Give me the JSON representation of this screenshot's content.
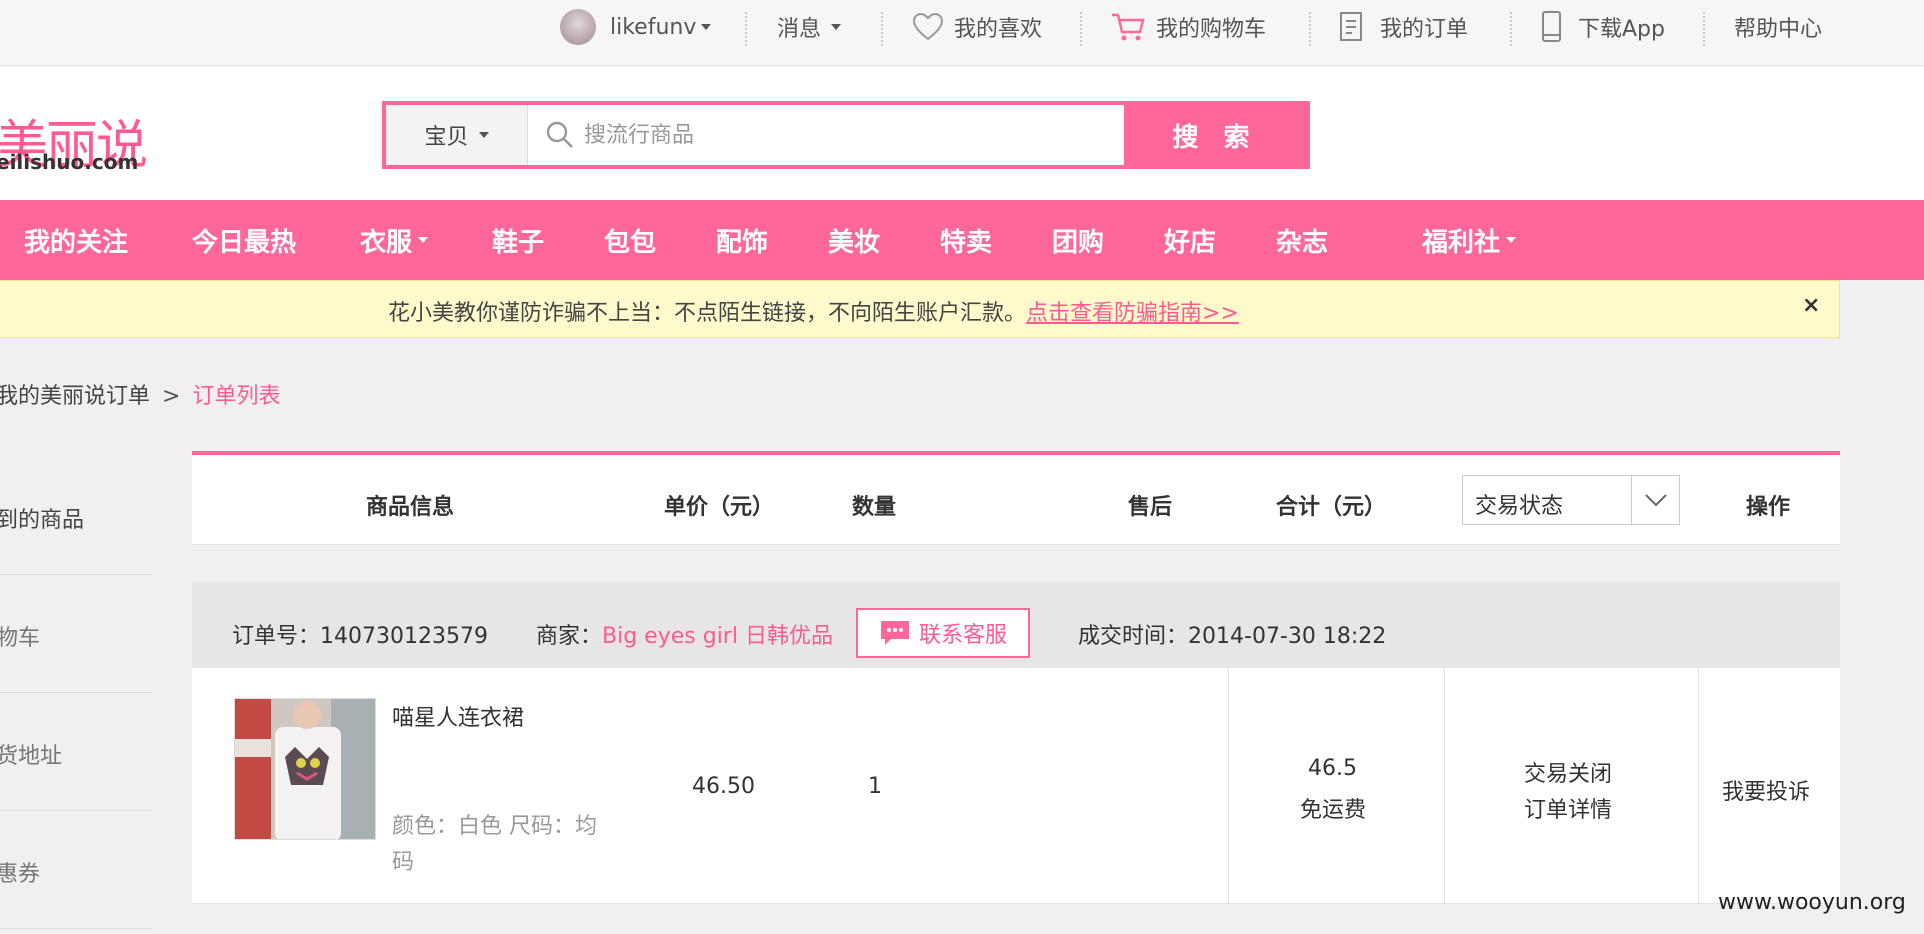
{
  "topbar": {
    "username": "likefunv",
    "messages": "消息",
    "favorites": "我的喜欢",
    "cart": "我的购物车",
    "orders": "我的订单",
    "download_app": "下载App",
    "help": "帮助中心"
  },
  "header": {
    "logo_main": "美丽说",
    "logo_sub": "eilishuo.com",
    "search": {
      "category": "宝贝",
      "placeholder": "搜流行商品",
      "button": "搜 索"
    }
  },
  "nav": {
    "items": [
      {
        "label": "我的关注"
      },
      {
        "label": "今日最热"
      },
      {
        "label": "衣服"
      },
      {
        "label": "鞋子"
      },
      {
        "label": "包包"
      },
      {
        "label": "配饰"
      },
      {
        "label": "美妆"
      },
      {
        "label": "特卖"
      },
      {
        "label": "团购"
      },
      {
        "label": "好店"
      },
      {
        "label": "杂志"
      },
      {
        "label": "福利社"
      }
    ]
  },
  "notice": {
    "text": "花小美教你谨防诈骗不上当：不点陌生链接，不向陌生账户汇款。",
    "link": "点击查看防骗指南>>",
    "close": "×"
  },
  "breadcrumb": {
    "parent": "我的美丽说订单",
    "separator": ">",
    "current": "订单列表"
  },
  "sidebar": {
    "items": [
      "到的商品",
      "物车",
      "货地址",
      "惠券"
    ]
  },
  "table": {
    "headers": {
      "product": "商品信息",
      "price": "单价（元）",
      "qty": "数量",
      "aftersale": "售后",
      "total": "合计（元）",
      "status_select": "交易状态",
      "action": "操作"
    }
  },
  "order": {
    "order_no_label": "订单号：",
    "order_no": "140730123579",
    "merchant_label": "商家：",
    "merchant": "Big eyes girl 日韩优品",
    "contact": "联系客服",
    "time_label": "成交时间：",
    "time": "2014-07-30 18:22",
    "item": {
      "name": "喵星人连衣裙",
      "attrs_line1": "颜色：白色 尺码：均",
      "attrs_line2": "码",
      "price": "46.50",
      "qty": "1"
    },
    "total": "46.5",
    "shipping": "免运费",
    "status": "交易关闭",
    "detail_link": "订单详情",
    "complain": "我要投诉"
  },
  "watermark": "www.wooyun.org",
  "colors": {
    "brand_pink": "#ff6699",
    "link_pink": "#ff5b91",
    "notice_bg": "#fffacc"
  }
}
